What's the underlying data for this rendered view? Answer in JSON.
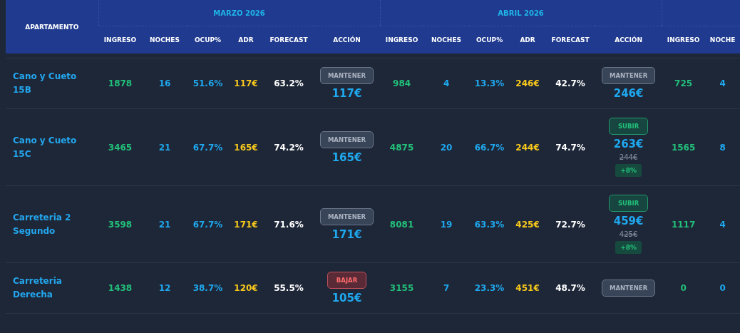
{
  "table": {
    "corner_header": "APARTAMENTO",
    "months": [
      {
        "title": "MARZO 2026",
        "columns": [
          "INGRESO",
          "NOCHES",
          "OCUP%",
          "ADR",
          "FORECAST",
          "ACCIÓN"
        ]
      },
      {
        "title": "ABRIL 2026",
        "columns": [
          "INGRESO",
          "NOCHES",
          "OCUP%",
          "ADR",
          "FORECAST",
          "ACCIÓN"
        ]
      },
      {
        "columns": [
          "INGRESO",
          "NOCHE"
        ]
      }
    ],
    "rows": [
      {
        "name": "Cano y Cueto 15B",
        "months": [
          {
            "ingreso": "1878",
            "noches": "16",
            "ocup": "51.6%",
            "adr": "117€",
            "forecast": "63.2%",
            "action": {
              "kind": "mantener",
              "label": "MANTENER",
              "price": "117€"
            }
          },
          {
            "ingreso": "984",
            "noches": "4",
            "ocup": "13.3%",
            "adr": "246€",
            "forecast": "42.7%",
            "action": {
              "kind": "mantener",
              "label": "MANTENER",
              "price": "246€"
            }
          },
          {
            "ingreso": "725",
            "noches": "4"
          }
        ]
      },
      {
        "name": "Cano y Cueto 15C",
        "months": [
          {
            "ingreso": "3465",
            "noches": "21",
            "ocup": "67.7%",
            "adr": "165€",
            "forecast": "74.2%",
            "action": {
              "kind": "mantener",
              "label": "MANTENER",
              "price": "165€"
            }
          },
          {
            "ingreso": "4875",
            "noches": "20",
            "ocup": "66.7%",
            "adr": "244€",
            "forecast": "74.7%",
            "action": {
              "kind": "subir",
              "label": "SUBIR",
              "price": "263€",
              "old_price": "244€",
              "change": "+8%"
            }
          },
          {
            "ingreso": "1565",
            "noches": "8"
          }
        ]
      },
      {
        "name": "Carreteria 2 Segundo",
        "months": [
          {
            "ingreso": "3598",
            "noches": "21",
            "ocup": "67.7%",
            "adr": "171€",
            "forecast": "71.6%",
            "action": {
              "kind": "mantener",
              "label": "MANTENER",
              "price": "171€"
            }
          },
          {
            "ingreso": "8081",
            "noches": "19",
            "ocup": "63.3%",
            "adr": "425€",
            "forecast": "72.7%",
            "action": {
              "kind": "subir",
              "label": "SUBIR",
              "price": "459€",
              "old_price": "425€",
              "change": "+8%"
            }
          },
          {
            "ingreso": "1117",
            "noches": "4"
          }
        ]
      },
      {
        "name": "Carreteria Derecha",
        "months": [
          {
            "ingreso": "1438",
            "noches": "12",
            "ocup": "38.7%",
            "adr": "120€",
            "forecast": "55.5%",
            "action": {
              "kind": "bajar",
              "label": "BAJAR",
              "price": "105€"
            }
          },
          {
            "ingreso": "3155",
            "noches": "7",
            "ocup": "23.3%",
            "adr": "451€",
            "forecast": "48.7%",
            "action": {
              "kind": "mantener",
              "label": "MANTENER"
            }
          },
          {
            "ingreso": "0",
            "noches": "0"
          }
        ]
      }
    ]
  }
}
